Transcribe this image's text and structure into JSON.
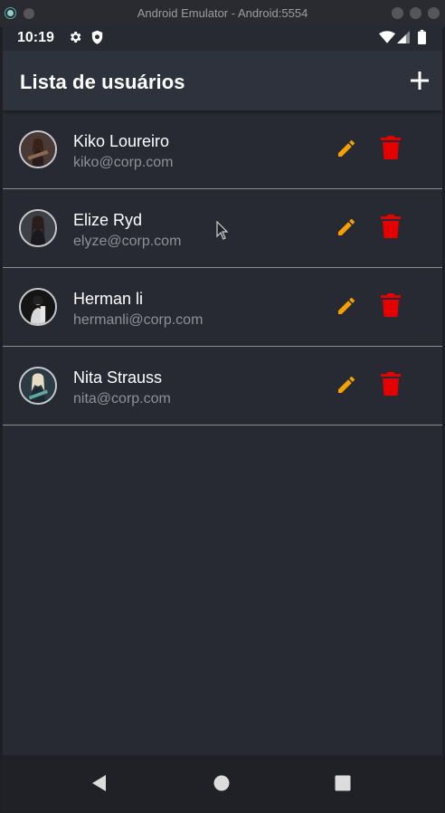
{
  "window": {
    "title": "Android Emulator - Android:5554"
  },
  "status_bar": {
    "time": "10:19",
    "icons": [
      "gear-icon",
      "shield-icon",
      "wifi-icon",
      "signal-icon",
      "battery-icon"
    ]
  },
  "app_bar": {
    "title": "Lista de usuários",
    "action_icon": "plus-icon"
  },
  "colors": {
    "edit": "#f5a000",
    "delete": "#e50000",
    "app_bar_bg": "#2e323c",
    "screen_bg": "#272a33"
  },
  "users": [
    {
      "name": "Kiko Loureiro",
      "email": "kiko@corp.com"
    },
    {
      "name": "Elize Ryd",
      "email": "elyze@corp.com"
    },
    {
      "name": "Herman li",
      "email": "hermanli@corp.com"
    },
    {
      "name": "Nita Strauss",
      "email": "nita@corp.com"
    }
  ],
  "nav_bar": {
    "icons": [
      "back-icon",
      "home-icon",
      "recents-icon"
    ]
  }
}
